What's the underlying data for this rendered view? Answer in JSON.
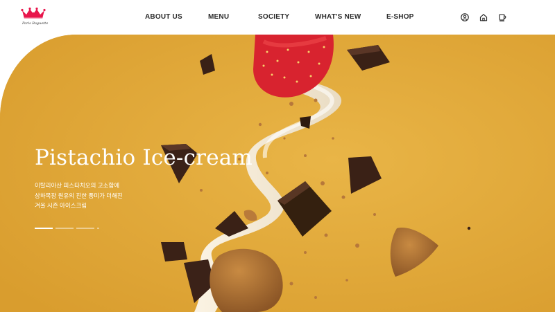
{
  "brand": {
    "name": "Paris Baguette",
    "accent": "#e8154b"
  },
  "nav": {
    "items": [
      {
        "label": "ABOUT US"
      },
      {
        "label": "MENU"
      },
      {
        "label": "SOCIETY"
      },
      {
        "label": "WHAT'S NEW"
      },
      {
        "label": "E-SHOP"
      }
    ]
  },
  "utility": [
    {
      "icon": "user-icon"
    },
    {
      "icon": "home-icon"
    },
    {
      "icon": "coffee-cup-icon"
    }
  ],
  "hero": {
    "title": "Pistachio Ice-cream",
    "desc": [
      "이탈리아산 피스타치오의 고소함에",
      "상하목장 원유의 진한 풍미가 더해진",
      "겨울 시즌 아이스크림"
    ],
    "background": "#dea538",
    "slides_total": 4,
    "active_slide": 1
  }
}
